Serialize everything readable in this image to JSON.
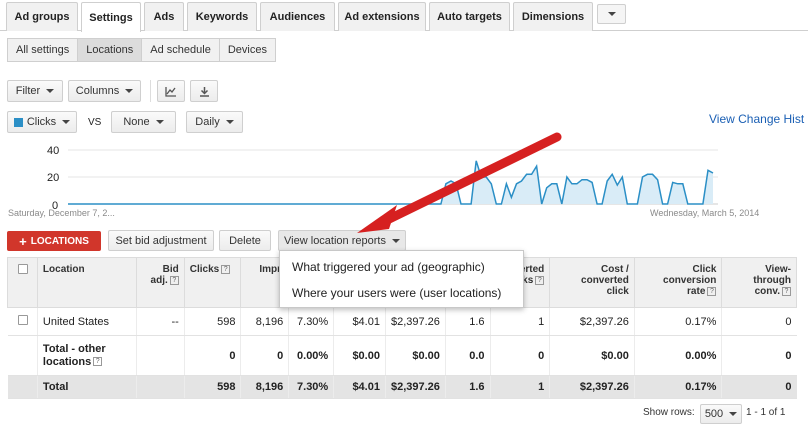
{
  "top_tabs": [
    "Ad groups",
    "Settings",
    "Ads",
    "Keywords",
    "Audiences",
    "Ad extensions",
    "Auto targets",
    "Dimensions"
  ],
  "active_top_tab": "Settings",
  "sub_tabs": [
    "All settings",
    "Locations",
    "Ad schedule",
    "Devices"
  ],
  "active_sub_tab": "Locations",
  "toolbar": {
    "filter": "Filter",
    "columns": "Columns",
    "metric": "Clicks",
    "vs": "VS",
    "compare": "None",
    "period": "Daily",
    "view_change_history": "View Change Hist"
  },
  "colors": {
    "accent": "#1a5fb4",
    "series": "#2b8fc6",
    "danger": "#d1362b"
  },
  "chart_data": {
    "type": "area",
    "y_ticks": [
      "40",
      "20",
      "0"
    ],
    "ylim": [
      0,
      40
    ],
    "x_start_label": "Saturday, December 7, 2...",
    "x_end_label": "Wednesday, March 5, 2014",
    "series": [
      {
        "values": [
          0,
          0,
          0,
          0,
          0,
          0,
          0,
          0,
          0,
          0,
          0,
          0,
          0,
          0,
          0,
          0,
          0,
          0,
          0,
          0,
          0,
          0,
          0,
          0,
          0,
          0,
          0,
          0,
          0,
          0,
          0,
          0,
          0,
          0,
          0,
          0,
          0,
          0,
          0,
          0,
          0,
          0,
          0,
          0,
          0,
          0,
          0,
          0,
          0,
          0,
          0,
          0,
          0,
          0,
          0,
          0,
          0,
          0,
          0,
          0,
          0,
          0,
          0,
          0,
          0,
          0,
          0,
          0,
          0,
          0,
          0,
          0,
          0,
          0,
          0,
          15,
          17,
          15,
          0,
          0,
          0,
          32,
          20,
          20,
          15,
          0,
          0,
          15,
          5,
          15,
          17,
          22,
          22,
          28,
          0,
          12,
          15,
          15,
          0,
          20,
          15,
          15,
          18,
          18,
          16,
          0,
          0,
          17,
          22,
          14,
          20,
          0,
          0,
          0,
          20,
          22,
          22,
          18,
          0,
          0,
          16,
          15,
          15,
          0,
          0,
          0,
          0,
          25,
          23
        ]
      }
    ]
  },
  "actions": {
    "locations_button": "LOCATIONS",
    "set_bid": "Set bid adjustment",
    "delete": "Delete",
    "view_reports": "View location reports"
  },
  "menu": {
    "item1": "What triggered your ad (geographic)",
    "item2": "Where your users were (user locations)"
  },
  "table": {
    "headers": {
      "location": "Location",
      "bid": "Bid",
      "bid2": "adj.",
      "clicks": "Clicks",
      "impr": "Impr.",
      "conv_clicks": "nverted",
      "conv_clicks2": "cks",
      "cost_conv": "Cost /",
      "cost_conv2": "converted",
      "cost_conv3": "click",
      "click_conv": "Click",
      "click_conv2": "conversion",
      "click_conv3": "rate",
      "view_through": "View-",
      "view_through2": "through",
      "view_through3": "conv."
    },
    "rows": [
      [
        "United States",
        "--",
        "598",
        "8,196",
        "7.30%",
        "$4.01",
        "$2,397.26",
        "1.6",
        "1",
        "$2,397.26",
        "0.17%",
        "0"
      ],
      [
        "Total - other",
        "",
        "0",
        "0",
        "0.00%",
        "$0.00",
        "$0.00",
        "0.0",
        "0",
        "$0.00",
        "0.00%",
        "0"
      ]
    ],
    "other_line2": "locations",
    "total": [
      "Total",
      "",
      "598",
      "8,196",
      "7.30%",
      "$4.01",
      "$2,397.26",
      "1.6",
      "1",
      "$2,397.26",
      "0.17%",
      "0"
    ]
  },
  "footer": {
    "show_rows": "Show rows:",
    "rows_value": "500",
    "pagination": "1 - 1 of 1"
  }
}
